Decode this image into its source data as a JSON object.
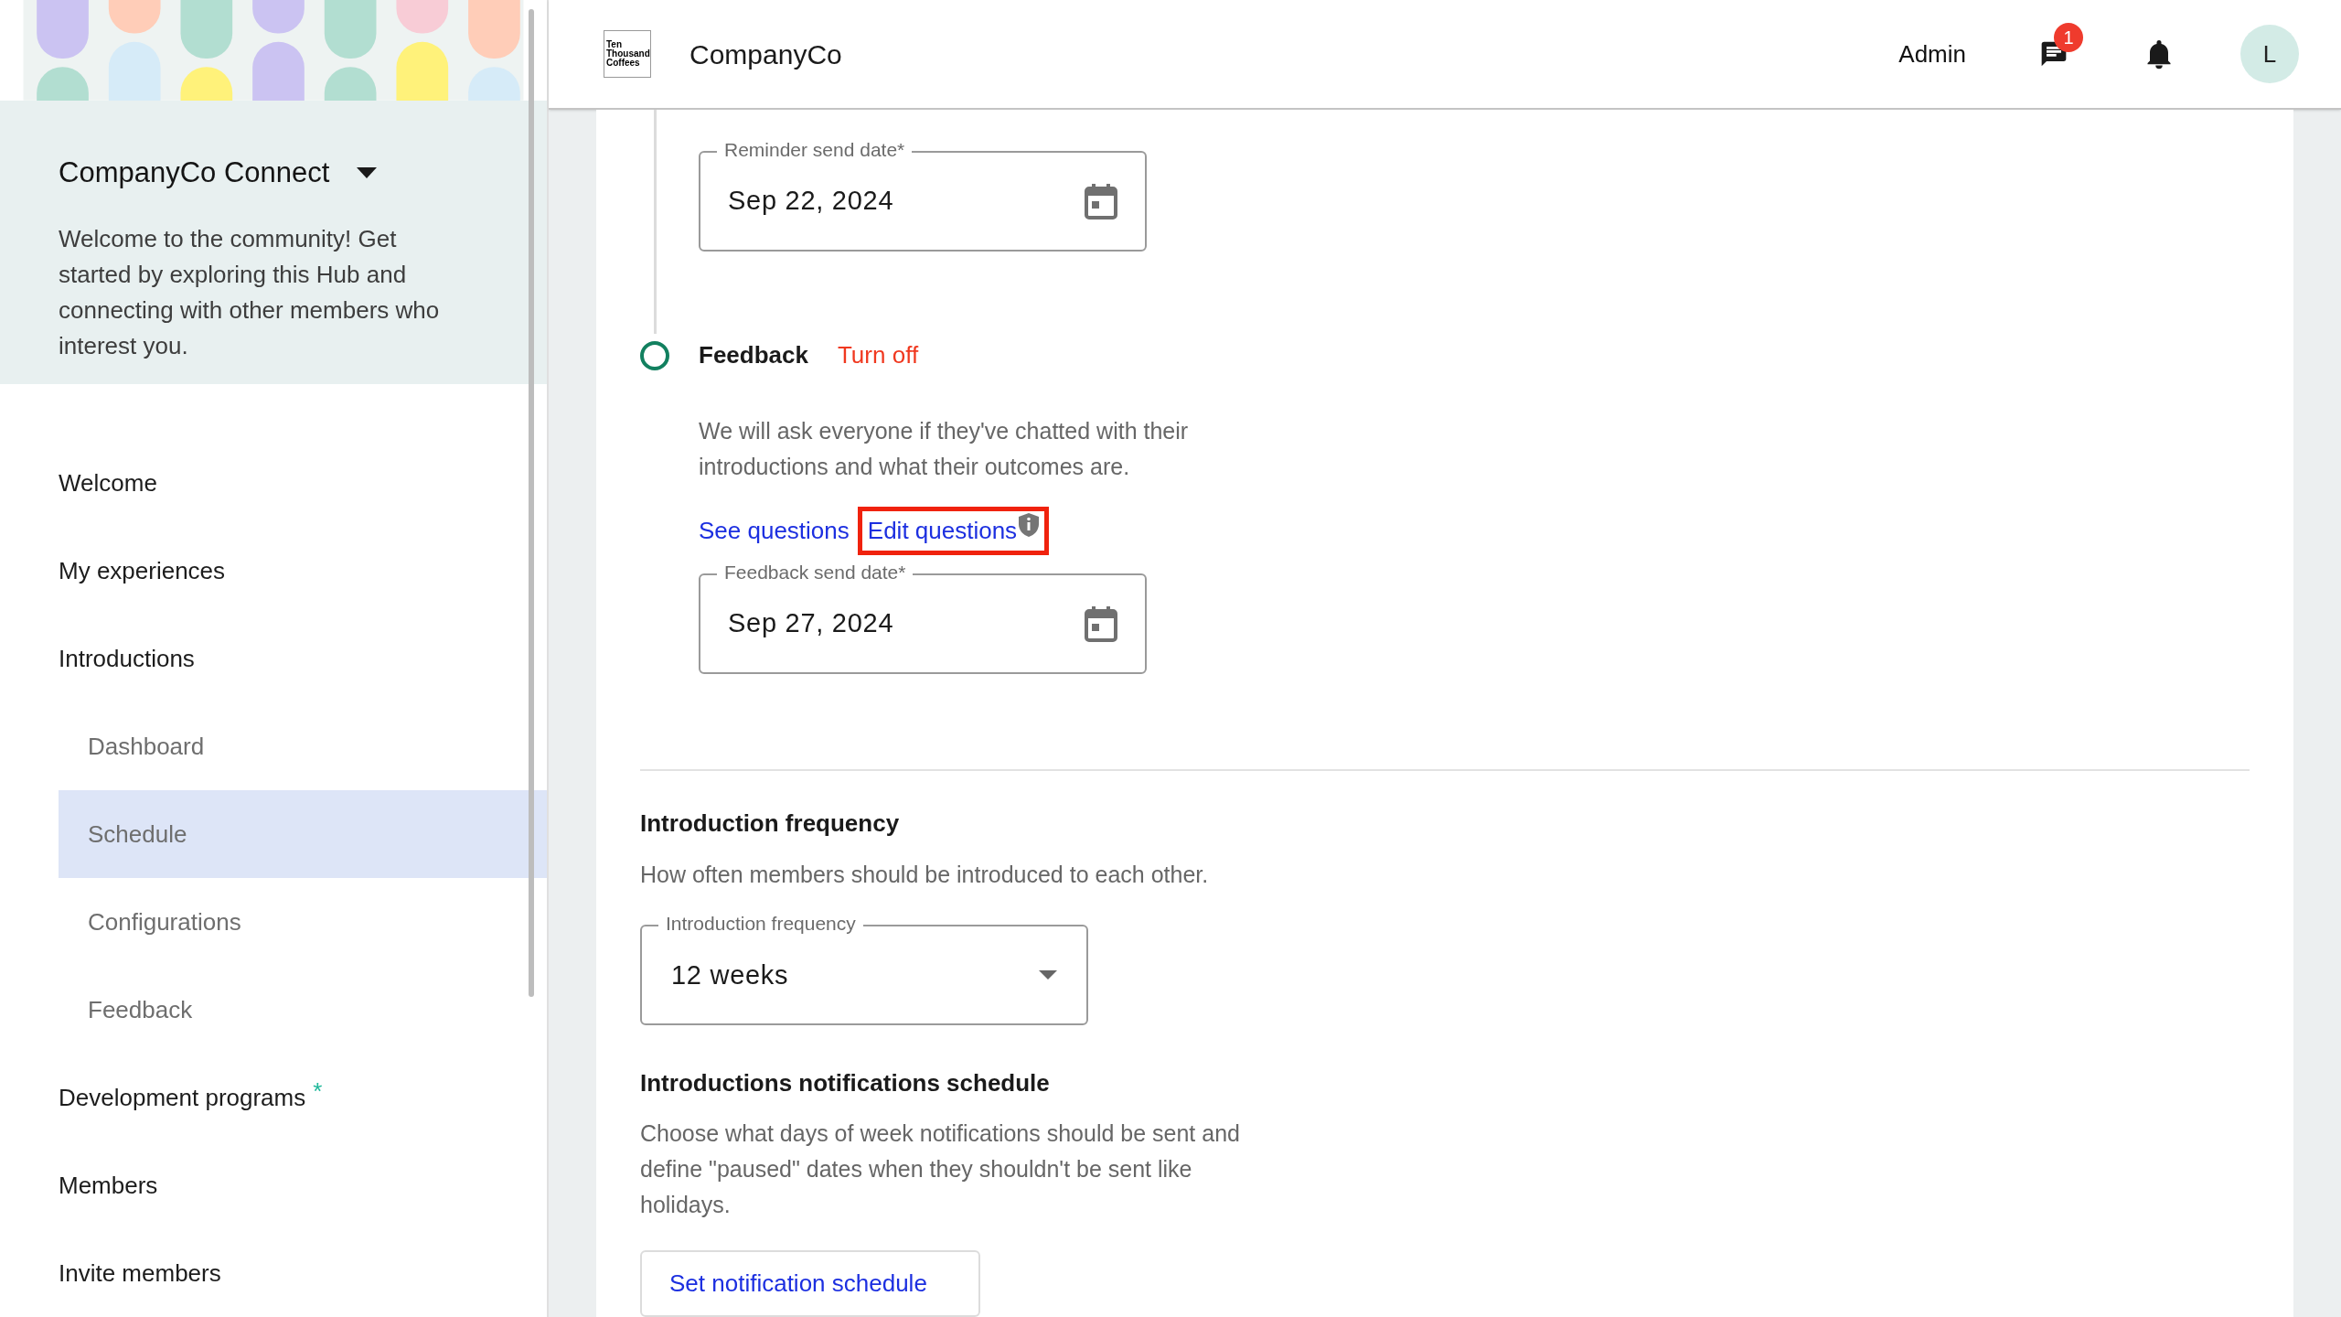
{
  "header": {
    "logo_text": "Ten Thousand Coffees",
    "company": "CompanyCo",
    "role": "Admin",
    "chat_badge": "1",
    "avatar": "L"
  },
  "sidebar": {
    "community": {
      "title": "CompanyCo Connect",
      "description": "Welcome to the community! Get started by exploring this Hub and connecting with other members who interest you."
    },
    "nav": [
      {
        "label": "Welcome",
        "selected": false
      },
      {
        "label": "My experiences",
        "selected": false
      },
      {
        "label": "Introductions",
        "selected": false,
        "children": [
          {
            "label": "Dashboard",
            "selected": false
          },
          {
            "label": "Schedule",
            "selected": true
          },
          {
            "label": "Configurations",
            "selected": false
          },
          {
            "label": "Feedback",
            "selected": false
          }
        ]
      },
      {
        "label": "Development programs",
        "selected": false,
        "badge": "*"
      },
      {
        "label": "Members",
        "selected": false
      },
      {
        "label": "Invite members",
        "selected": false
      }
    ]
  },
  "reminder_field": {
    "label": "Reminder send date*",
    "value": "Sep 22, 2024"
  },
  "feedback_step": {
    "title": "Feedback",
    "toggle": "Turn off",
    "description": "We will ask everyone if they've chatted with their introductions and what their outcomes are.",
    "links": [
      {
        "label": "See questions",
        "highlighted": false,
        "info": false
      },
      {
        "label": "Edit questions",
        "highlighted": true,
        "info": true
      }
    ],
    "field": {
      "label": "Feedback send date*",
      "value": "Sep 27, 2024"
    }
  },
  "frequency": {
    "heading": "Introduction frequency",
    "description": "How often members should be introduced to each other.",
    "select": {
      "label": "Introduction frequency",
      "value": "12 weeks"
    }
  },
  "notifications": {
    "heading": "Introductions notifications schedule",
    "description": "Choose what days of week notifications should be sent and define \"paused\" dates when they shouldn't be sent like holidays.",
    "button": "Set notification schedule"
  }
}
